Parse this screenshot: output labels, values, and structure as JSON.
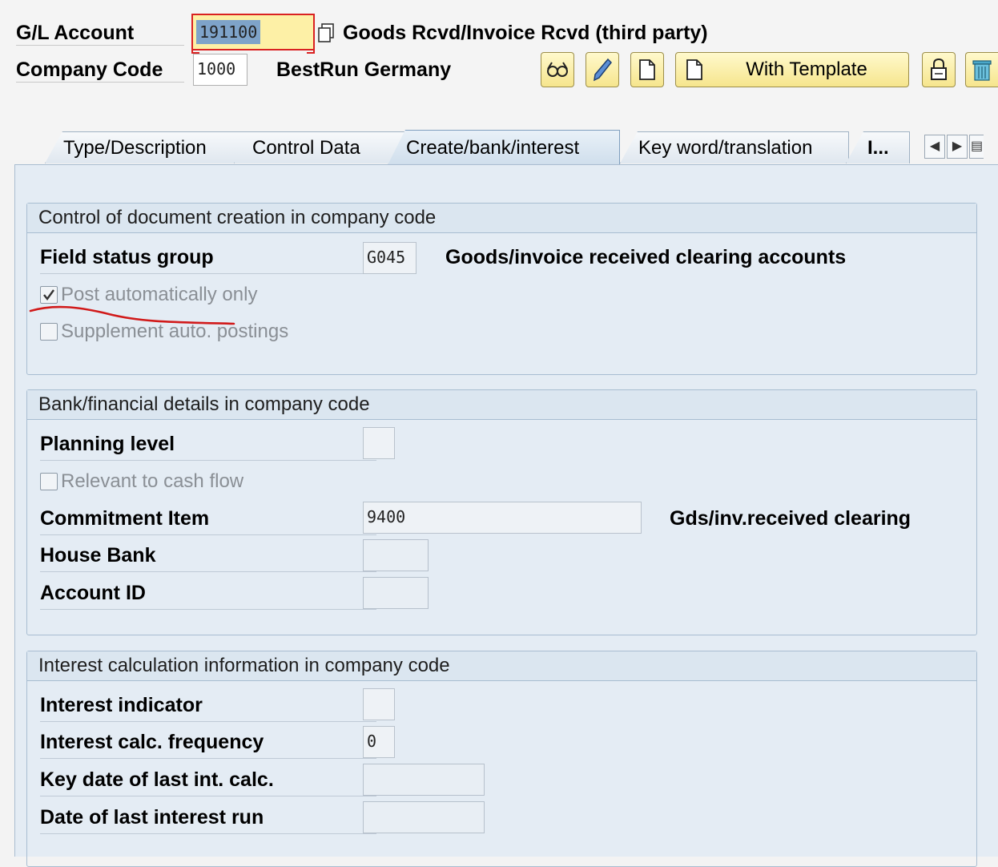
{
  "header": {
    "gl_account_label": "G/L Account",
    "gl_account_value": "191100",
    "gl_account_text": "Goods Rcvd/Invoice Rcvd (third party)",
    "company_code_label": "Company Code",
    "company_code_value": "1000",
    "company_name": "BestRun Germany",
    "with_template_label": "With Template"
  },
  "tabs": [
    {
      "label": "Type/Description"
    },
    {
      "label": "Control Data"
    },
    {
      "label": "Create/bank/interest"
    },
    {
      "label": "Key word/translation"
    },
    {
      "label": "I..."
    }
  ],
  "groups": {
    "doc_creation": {
      "title": "Control of document creation in company code",
      "field_status_group_label": "Field status group",
      "field_status_group_value": "G045",
      "field_status_group_text": "Goods/invoice received clearing accounts",
      "post_auto_label": "Post automatically only",
      "supplement_label": "Supplement auto. postings"
    },
    "bank": {
      "title": "Bank/financial details in company code",
      "planning_level_label": "Planning level",
      "cash_flow_label": "Relevant to cash flow",
      "commitment_item_label": "Commitment Item",
      "commitment_item_value": "9400",
      "commitment_item_text": "Gds/inv.received clearing",
      "house_bank_label": "House Bank",
      "account_id_label": "Account ID"
    },
    "interest": {
      "title": "Interest calculation information in company code",
      "interest_indicator_label": "Interest indicator",
      "calc_frequency_label": "Interest calc. frequency",
      "calc_frequency_value": "0",
      "key_date_label": "Key date of last int. calc.",
      "last_run_label": "Date of last interest run"
    }
  },
  "icons": {
    "glasses": "display-change-icon",
    "pencil": "edit-icon",
    "document": "create-icon",
    "lock": "lock-icon",
    "trash": "delete-icon"
  },
  "colors": {
    "annotation": "#d11a1a",
    "toolbar_button": "#f6e58d",
    "panel": "#e4ecf4"
  }
}
